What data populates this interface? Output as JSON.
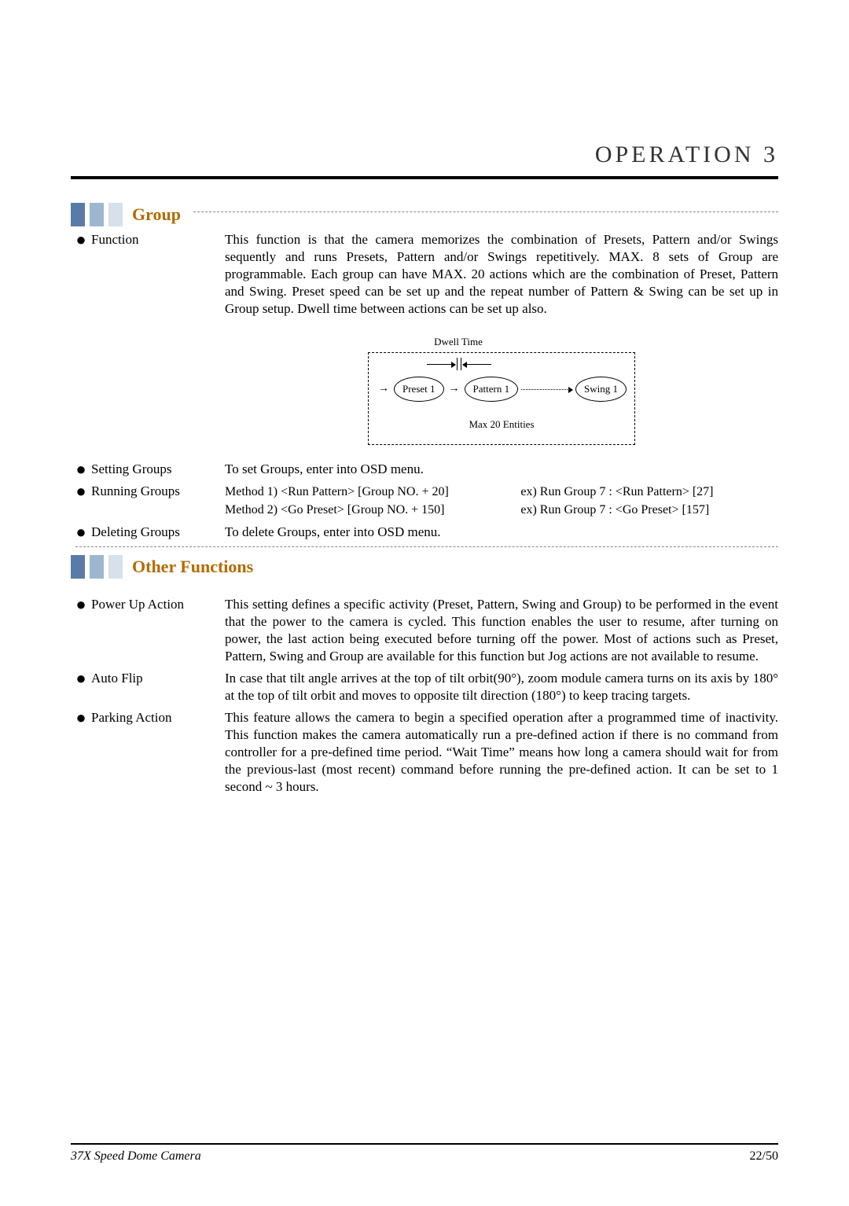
{
  "chapter_title": "OPERATION 3",
  "sections": {
    "group": {
      "title": "Group",
      "function": {
        "label": "Function",
        "text": "This function is that the camera memorizes the combination of Presets, Pattern and/or Swings sequently and runs Presets, Pattern and/or Swings repetitively. MAX. 8 sets of Group are programmable. Each group can have MAX. 20 actions which are the combination of Preset, Pattern and Swing. Preset speed can be set up and the repeat number of Pattern & Swing can be set up in Group setup. Dwell time between actions can be set up also."
      },
      "diagram": {
        "top_label": "Dwell Time",
        "nodes": {
          "a": "Preset 1",
          "b": "Pattern 1",
          "c": "Swing 1"
        },
        "bottom_label": "Max 20 Entities"
      },
      "setting": {
        "label": "Setting Groups",
        "text": "To set Groups, enter into OSD menu."
      },
      "running": {
        "label": "Running Groups",
        "left_m1": "Method 1) <Run Pattern> [Group NO. + 20]",
        "left_m2": "Method 2) <Go Preset> [Group NO. + 150]",
        "right_ex1": "ex) Run Group 7 : <Run Pattern> [27]",
        "right_ex2": "ex) Run Group 7 : <Go Preset> [157]"
      },
      "deleting": {
        "label": "Deleting Groups",
        "text": "To delete Groups, enter into OSD menu."
      }
    },
    "other": {
      "title": "Other Functions",
      "powerup": {
        "label": "Power Up Action",
        "text": "This setting defines a specific activity (Preset, Pattern, Swing and Group) to be performed in the event that the power to the camera is cycled. This function enables the user to resume, after turning on power, the last action being executed before turning off the power. Most of actions such as Preset, Pattern, Swing and Group are available for this function but Jog actions are not available to resume."
      },
      "autoflip": {
        "label": "Auto Flip",
        "text": "In case that tilt angle arrives at the top of tilt orbit(90°), zoom module camera turns on its axis by 180° at the top of tilt orbit and moves to opposite tilt direction (180°) to keep tracing targets."
      },
      "parking": {
        "label": "Parking Action",
        "text": "This feature allows the camera to begin a specified operation after a programmed time of inactivity. This function makes the camera automatically run a pre-defined action if there is no command from controller for a pre-defined time period. “Wait Time” means how long a camera should wait for from the previous-last (most recent) command before running the pre-defined action. It can be set to 1 second ~ 3 hours."
      }
    }
  },
  "footer": {
    "left": "37X Speed Dome Camera",
    "right": "22/50"
  }
}
